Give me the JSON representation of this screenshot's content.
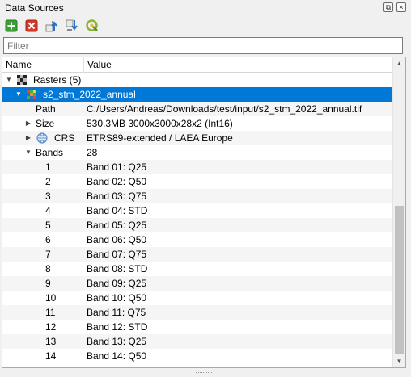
{
  "panel": {
    "title": "Data Sources"
  },
  "toolbar": {
    "tools": [
      {
        "name": "add-layer-icon",
        "color": "#3aa033"
      },
      {
        "name": "remove-layer-icon",
        "color": "#d33a2c"
      },
      {
        "name": "move-up-icon",
        "color": "#2c6fc6"
      },
      {
        "name": "move-down-icon",
        "color": "#2c6fc6"
      },
      {
        "name": "open-in-qgis-icon",
        "color": "#8ab533"
      }
    ]
  },
  "filter": {
    "value": "",
    "placeholder": "Filter"
  },
  "columns": {
    "name": "Name",
    "value": "Value"
  },
  "tree": {
    "rasters": {
      "label": "Rasters (5)"
    },
    "layer": {
      "label": "s2_stm_2022_annual"
    },
    "path": {
      "name": "Path",
      "value": "C:/Users/Andreas/Downloads/test/input/s2_stm_2022_annual.tif"
    },
    "size": {
      "name": "Size",
      "value": "530.3MB 3000x3000x28x2 (Int16)"
    },
    "crs": {
      "name": "CRS",
      "value": "ETRS89-extended / LAEA Europe"
    },
    "bands": {
      "name": "Bands",
      "value": "28"
    },
    "band_list": [
      {
        "num": "1",
        "label": "Band 01: Q25"
      },
      {
        "num": "2",
        "label": "Band 02: Q50"
      },
      {
        "num": "3",
        "label": "Band 03: Q75"
      },
      {
        "num": "4",
        "label": "Band 04: STD"
      },
      {
        "num": "5",
        "label": "Band 05: Q25"
      },
      {
        "num": "6",
        "label": "Band 06: Q50"
      },
      {
        "num": "7",
        "label": "Band 07: Q75"
      },
      {
        "num": "8",
        "label": "Band 08: STD"
      },
      {
        "num": "9",
        "label": "Band 09: Q25"
      },
      {
        "num": "10",
        "label": "Band 10: Q50"
      },
      {
        "num": "11",
        "label": "Band 11: Q75"
      },
      {
        "num": "12",
        "label": "Band 12: STD"
      },
      {
        "num": "13",
        "label": "Band 13: Q25"
      },
      {
        "num": "14",
        "label": "Band 14: Q50"
      }
    ]
  },
  "colors": {
    "selection": "#0078d7",
    "alt_row": "#f5f5f5"
  }
}
